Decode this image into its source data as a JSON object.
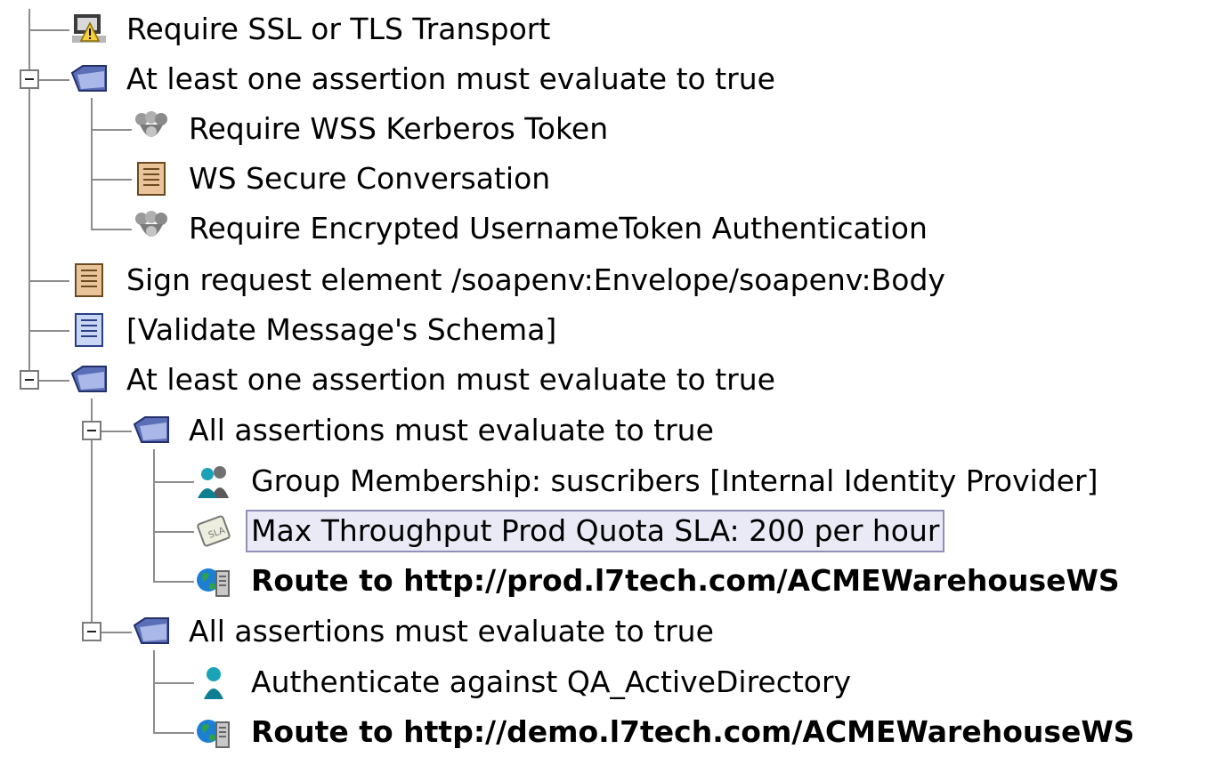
{
  "policy_tree": {
    "nodes": [
      {
        "id": "n0",
        "label": "Require SSL or TLS Transport",
        "icon": "ssl-transport-icon"
      },
      {
        "id": "n1",
        "label": "At least one assertion must evaluate to true",
        "icon": "folder-icon"
      },
      {
        "id": "n2",
        "label": "Require WSS Kerberos Token",
        "icon": "kerberos-icon"
      },
      {
        "id": "n3",
        "label": "WS Secure Conversation",
        "icon": "xml-document-icon"
      },
      {
        "id": "n4",
        "label": "Require Encrypted UsernameToken Authentication",
        "icon": "kerberos-icon"
      },
      {
        "id": "n5",
        "label": "Sign request element /soapenv:Envelope/soapenv:Body",
        "icon": "xml-document-icon"
      },
      {
        "id": "n6",
        "label": "[Validate Message's Schema]",
        "icon": "xml-schema-document-icon"
      },
      {
        "id": "n7",
        "label": "At least one assertion must evaluate to true",
        "icon": "folder-icon"
      },
      {
        "id": "n8",
        "label": "All assertions must evaluate to true",
        "icon": "folder-icon"
      },
      {
        "id": "n9",
        "label": "Group Membership: suscribers [Internal Identity Provider]",
        "icon": "group-users-icon"
      },
      {
        "id": "n10",
        "label": "Max Throughput Prod Quota SLA: 200 per hour",
        "icon": "throughput-quota-icon",
        "selected": true
      },
      {
        "id": "n11",
        "label": "Route to http://prod.l7tech.com/ACMEWarehouseWS",
        "icon": "route-server-icon",
        "bold": true
      },
      {
        "id": "n12",
        "label": "All assertions must evaluate to true",
        "icon": "folder-icon"
      },
      {
        "id": "n13",
        "label": "Authenticate against QA_ActiveDirectory",
        "icon": "user-icon"
      },
      {
        "id": "n14",
        "label": "Route to http://demo.l7tech.com/ACMEWarehouseWS",
        "icon": "route-server-icon",
        "bold": true
      }
    ],
    "expanded_toggles": [
      "n1",
      "n7",
      "n8",
      "n12"
    ]
  }
}
